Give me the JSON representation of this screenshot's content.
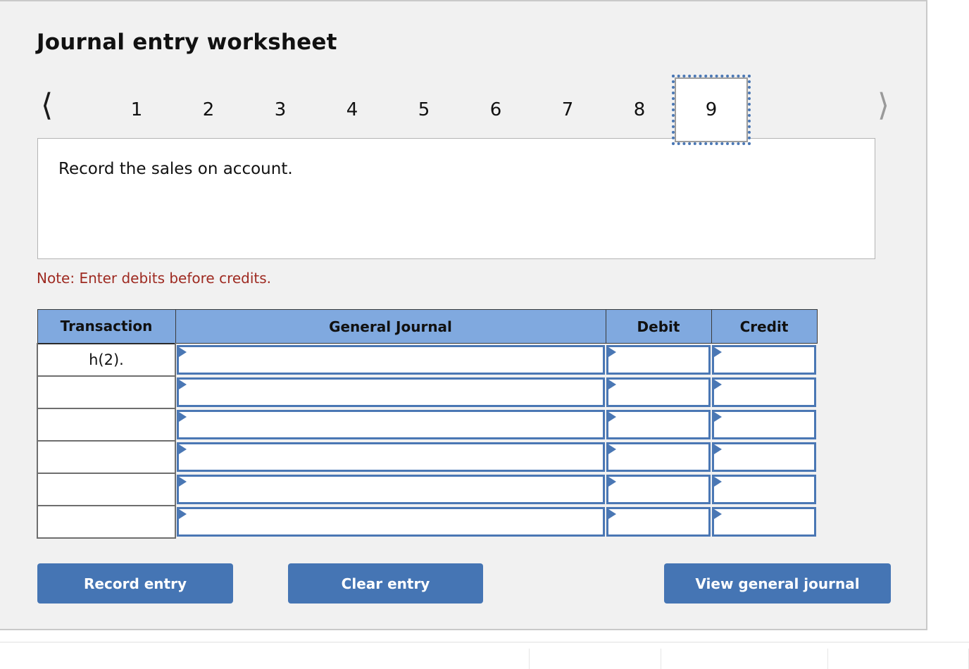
{
  "worksheet": {
    "title": "Journal entry worksheet",
    "description": "Record the sales on account.",
    "note": "Note: Enter debits before credits."
  },
  "tabs": {
    "prev_icon": "chevron-left-icon",
    "next_icon": "chevron-right-icon",
    "items": [
      {
        "label": "1",
        "selected": false
      },
      {
        "label": "2",
        "selected": false
      },
      {
        "label": "3",
        "selected": false
      },
      {
        "label": "4",
        "selected": false
      },
      {
        "label": "5",
        "selected": false
      },
      {
        "label": "6",
        "selected": false
      },
      {
        "label": "7",
        "selected": false
      },
      {
        "label": "8",
        "selected": false
      },
      {
        "label": "9",
        "selected": true
      }
    ],
    "selected_label": "9"
  },
  "table": {
    "headers": {
      "transaction": "Transaction",
      "general_journal": "General Journal",
      "debit": "Debit",
      "credit": "Credit"
    },
    "rows": [
      {
        "transaction": "h(2).",
        "general_journal": "",
        "debit": "",
        "credit": ""
      },
      {
        "transaction": "",
        "general_journal": "",
        "debit": "",
        "credit": ""
      },
      {
        "transaction": "",
        "general_journal": "",
        "debit": "",
        "credit": ""
      },
      {
        "transaction": "",
        "general_journal": "",
        "debit": "",
        "credit": ""
      },
      {
        "transaction": "",
        "general_journal": "",
        "debit": "",
        "credit": ""
      },
      {
        "transaction": "",
        "general_journal": "",
        "debit": "",
        "credit": ""
      }
    ]
  },
  "buttons": {
    "record_entry": "Record entry",
    "clear_entry": "Clear entry",
    "view_general_journal": "View general journal"
  },
  "colors": {
    "panel_background": "#f1f1f1",
    "header_blue": "#80a9df",
    "accent_blue": "#4a77b4",
    "button_blue": "#4575b4",
    "note_red": "#9e2a21"
  }
}
